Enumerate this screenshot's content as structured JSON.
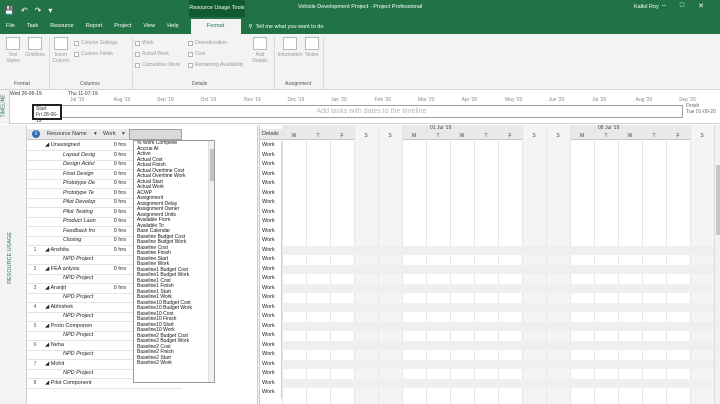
{
  "titlebar": {
    "context_tab": "Resource Usage Tools",
    "doc_title": "Vehicle Development Project - Project Professional",
    "user": "Kallol Roy",
    "qat_icons": [
      "save-icon",
      "undo-icon",
      "redo-icon",
      "dropdown-icon"
    ],
    "win_buttons": [
      "–",
      "□",
      "✕"
    ]
  },
  "tabs": [
    "File",
    "Task",
    "Resource",
    "Report",
    "Project",
    "View",
    "Help",
    "Format"
  ],
  "active_tab": "Format",
  "tellme": "Tell me what you want to do",
  "ribbon": {
    "text_styles": "Text Styles",
    "gridlines": "Gridlines",
    "insert_column": "Insert Column",
    "column_settings": "Column Settings",
    "custom_fields": "Custom Fields",
    "work": "Work",
    "actual_work": "Actual Work",
    "cumulative_work": "Cumulative Work",
    "overallocation": "Overallocation",
    "cost": "Cost",
    "remaining_availability": "Remaining Availability",
    "add_details": "Add Details",
    "information": "Information",
    "notes": "Notes",
    "groups": [
      "Format",
      "Columns",
      "Details",
      "Assignment"
    ]
  },
  "timeline": {
    "label": "TIMELINE",
    "today": "Thu 11-07-19",
    "left_date": "Wed 26-06-19",
    "start_label": "Start",
    "start_date": "Fri 28-06-19",
    "finish_label": "Finish",
    "finish_date": "Tue 01-09-20",
    "placeholder": "Add tasks with dates to the timeline",
    "months": [
      "Jul '19",
      "Aug '19",
      "Sep '19",
      "Oct '19",
      "Nov '19",
      "Dec '19",
      "Jan '20",
      "Feb '20",
      "Mar '20",
      "Apr '20",
      "May '20",
      "Jun '20",
      "Jul '20",
      "Aug '20",
      "Sep '20"
    ]
  },
  "sidebar_label": "RESOURCE USAGE",
  "table": {
    "col_name": "Resource Name",
    "col_work": "Work",
    "col_detail": "Details",
    "rows": [
      {
        "num": "",
        "name": "◢ Unassigned",
        "work": "0 hrs",
        "indent": 0,
        "italic": false
      },
      {
        "num": "",
        "name": "Layout Desig",
        "work": "0 hrs",
        "indent": 2,
        "italic": true
      },
      {
        "num": "",
        "name": "Design Activi",
        "work": "0 hrs",
        "indent": 2,
        "italic": true
      },
      {
        "num": "",
        "name": "Final Design",
        "work": "0 hrs",
        "indent": 2,
        "italic": true
      },
      {
        "num": "",
        "name": "Prototype De",
        "work": "0 hrs",
        "indent": 2,
        "italic": true
      },
      {
        "num": "",
        "name": "Prototype Te",
        "work": "0 hrs",
        "indent": 2,
        "italic": true
      },
      {
        "num": "",
        "name": "Pilot Develop",
        "work": "0 hrs",
        "indent": 2,
        "italic": true
      },
      {
        "num": "",
        "name": "Pilot Testing",
        "work": "0 hrs",
        "indent": 2,
        "italic": true
      },
      {
        "num": "",
        "name": "Product Laun",
        "work": "0 hrs",
        "indent": 2,
        "italic": true
      },
      {
        "num": "",
        "name": "Feedback fro",
        "work": "0 hrs",
        "indent": 2,
        "italic": true
      },
      {
        "num": "",
        "name": "Closing",
        "work": "0 hrs",
        "indent": 2,
        "italic": true
      },
      {
        "num": "1",
        "name": "◢ Anshita",
        "work": "0 hrs",
        "indent": 0,
        "italic": false
      },
      {
        "num": "",
        "name": "NPD Project",
        "work": "",
        "indent": 2,
        "italic": true
      },
      {
        "num": "2",
        "name": "◢ FEA anlysis",
        "work": "0 hrs",
        "indent": 0,
        "italic": false
      },
      {
        "num": "",
        "name": "NPD Project",
        "work": "",
        "indent": 2,
        "italic": true
      },
      {
        "num": "3",
        "name": "◢ Aranjit",
        "work": "0 hrs",
        "indent": 0,
        "italic": false
      },
      {
        "num": "",
        "name": "NPD Project",
        "work": "",
        "indent": 2,
        "italic": true
      },
      {
        "num": "4",
        "name": "◢ Abhishek",
        "work": "",
        "indent": 0,
        "italic": false
      },
      {
        "num": "",
        "name": "NPD Project",
        "work": "",
        "indent": 2,
        "italic": true
      },
      {
        "num": "5",
        "name": "◢ Proto Componen",
        "work": "",
        "indent": 0,
        "italic": false
      },
      {
        "num": "",
        "name": "NPD Project",
        "work": "",
        "indent": 2,
        "italic": true
      },
      {
        "num": "6",
        "name": "◢ Neha",
        "work": "",
        "indent": 0,
        "italic": false
      },
      {
        "num": "",
        "name": "NPD Project",
        "work": "",
        "indent": 2,
        "italic": true
      },
      {
        "num": "7",
        "name": "◢ Mohit",
        "work": "",
        "indent": 0,
        "italic": false
      },
      {
        "num": "",
        "name": "NPD Project",
        "work": "",
        "indent": 2,
        "italic": true
      },
      {
        "num": "8",
        "name": "◢ Pilot Component",
        "work": "",
        "indent": 0,
        "italic": false
      }
    ],
    "detail_value": "Work"
  },
  "dropdown_items": [
    "% Work Complete",
    "Accrue At",
    "Active",
    "Actual Cost",
    "Actual Finish",
    "Actual Overtime Cost",
    "Actual Overtime Work",
    "Actual Start",
    "Actual Work",
    "ACWP",
    "Assignment",
    "Assignment Delay",
    "Assignment Owner",
    "Assignment Units",
    "Available From",
    "Available To",
    "Base Calendar",
    "Baseline Budget Cost",
    "Baseline Budget Work",
    "Baseline Cost",
    "Baseline Finish",
    "Baseline Start",
    "Baseline Work",
    "Baseline1 Budget Cost",
    "Baseline1 Budget Work",
    "Baseline1 Cost",
    "Baseline1 Finish",
    "Baseline1 Start",
    "Baseline1 Work",
    "Baseline10 Budget Cost",
    "Baseline10 Budget Work",
    "Baseline10 Cost",
    "Baseline10 Finish",
    "Baseline10 Start",
    "Baseline10 Work",
    "Baseline2 Budget Cost",
    "Baseline2 Budget Work",
    "Baseline2 Cost",
    "Baseline2 Finish",
    "Baseline2 Start",
    "Baseline2 Work"
  ],
  "timescale": {
    "weeks": [
      {
        "label": "",
        "col": 0
      },
      {
        "label": "01 Jul '19",
        "col": 6
      },
      {
        "label": "08 Jul '19",
        "col": 13
      }
    ],
    "days": [
      "W",
      "T",
      "F",
      "S",
      "S",
      "M",
      "T",
      "W",
      "T",
      "F",
      "S",
      "S",
      "M",
      "T",
      "W",
      "T",
      "F",
      "S"
    ]
  }
}
